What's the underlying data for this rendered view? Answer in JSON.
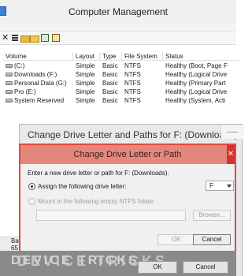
{
  "window": {
    "title": "Computer Management"
  },
  "table": {
    "columns": [
      "Volume",
      "Layout",
      "Type",
      "File System",
      "Status"
    ],
    "rows": [
      {
        "volume": "(C:)",
        "layout": "Simple",
        "type": "Basic",
        "fs": "NTFS",
        "status": "Healthy (Boot, Page F"
      },
      {
        "volume": "Downloads (F:)",
        "layout": "Simple",
        "type": "Basic",
        "fs": "NTFS",
        "status": "Healthy (Logical Drive"
      },
      {
        "volume": "Personal Data (G:)",
        "layout": "Simple",
        "type": "Basic",
        "fs": "NTFS",
        "status": "Healthy (Primary Part"
      },
      {
        "volume": "Pro (E:)",
        "layout": "Simple",
        "type": "Basic",
        "fs": "NTFS",
        "status": "Healthy (Logical Drive"
      },
      {
        "volume": "System Reserved",
        "layout": "Simple",
        "type": "Basic",
        "fs": "NTFS",
        "status": "Healthy (System, Acti"
      }
    ]
  },
  "background_dialog": {
    "title": "Change Drive Letter and Paths for F: (Downloads)",
    "ok_label": "OK",
    "cancel_label": "Cancel"
  },
  "left_fragment": {
    "line1": "Ba",
    "line2": "65",
    "line3": "Or"
  },
  "dialog": {
    "title": "Change Drive Letter or Path",
    "close_glyph": "✕",
    "instruction": "Enter a new drive letter or path for F: (Downloads).",
    "option_assign": "Assign the following drive letter:",
    "option_mount": "Mount in the following empty NTFS folder:",
    "selected_letter": "F",
    "browse_label": "Browse...",
    "ok_label": "OK",
    "cancel_label": "Cancel"
  },
  "watermark": {
    "text": "DEVICE TRICKS",
    "ghost": "DEVICE TRICKS"
  },
  "icons": {
    "close": "close-icon",
    "properties": "properties-icon",
    "folder": "folder-icon",
    "open": "open-icon",
    "help": "help-icon",
    "view": "view-icon",
    "volume": "drive-icon",
    "dropdown": "chevron-down-icon"
  },
  "colors": {
    "dialog_border": "#e04a3e",
    "dialog_title_bar": "#e3877d",
    "watermark_band": "#8a8a8a"
  }
}
